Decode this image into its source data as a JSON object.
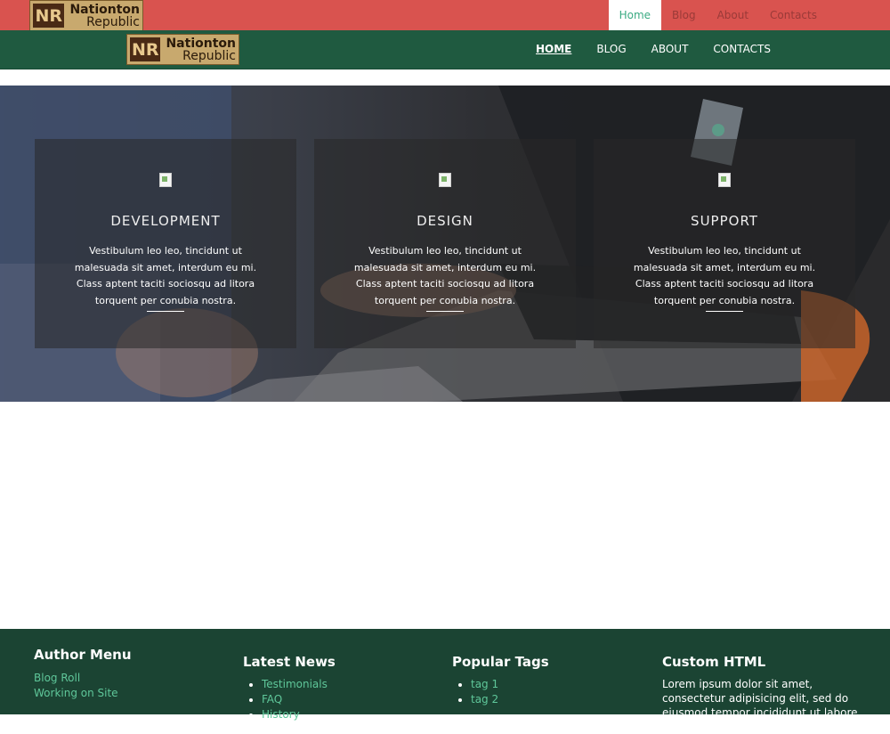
{
  "brand": {
    "initials": "NR",
    "line1": "Nationton",
    "line2": "Republic"
  },
  "top_nav": [
    {
      "label": "Home",
      "active": true
    },
    {
      "label": "Blog",
      "active": false
    },
    {
      "label": "About",
      "active": false
    },
    {
      "label": "Contacts",
      "active": false
    }
  ],
  "main_nav": [
    {
      "label": "HOME",
      "active": true
    },
    {
      "label": "BLOG",
      "active": false
    },
    {
      "label": "ABOUT",
      "active": false
    },
    {
      "label": "CONTACTS",
      "active": false
    }
  ],
  "features": [
    {
      "icon": "broken-image-icon",
      "title": "DEVELOPMENT",
      "text": "Vestibulum leo leo, tincidunt ut malesuada sit amet, interdum eu mi. Class aptent taciti sociosqu ad litora torquent per conubia nostra."
    },
    {
      "icon": "broken-image-icon",
      "title": "DESIGN",
      "text": "Vestibulum leo leo, tincidunt ut malesuada sit amet, interdum eu mi. Class aptent taciti sociosqu ad litora torquent per conubia nostra."
    },
    {
      "icon": "broken-image-icon",
      "title": "SUPPORT",
      "text": "Vestibulum leo leo, tincidunt ut malesuada sit amet, interdum eu mi. Class aptent taciti sociosqu ad litora torquent per conubia nostra."
    }
  ],
  "footer": {
    "author_menu": {
      "title": "Author Menu",
      "links": [
        "Blog Roll",
        "Working on Site"
      ]
    },
    "latest_news": {
      "title": "Latest News",
      "items": [
        "Testimonials",
        "FAQ",
        "History"
      ]
    },
    "popular_tags": {
      "title": "Popular Tags",
      "items": [
        "tag 1",
        "tag 2"
      ]
    },
    "custom_html": {
      "title": "Custom HTML",
      "text": "Lorem ipsum dolor sit amet, consectetur adipisicing elit, sed do eiusmod tempor incididunt ut labore et dolore magna"
    }
  },
  "colors": {
    "top_bar": "#d9534f",
    "main_bar": "#1f5a40",
    "footer": "#1b4433",
    "accent": "#3aaa82"
  }
}
